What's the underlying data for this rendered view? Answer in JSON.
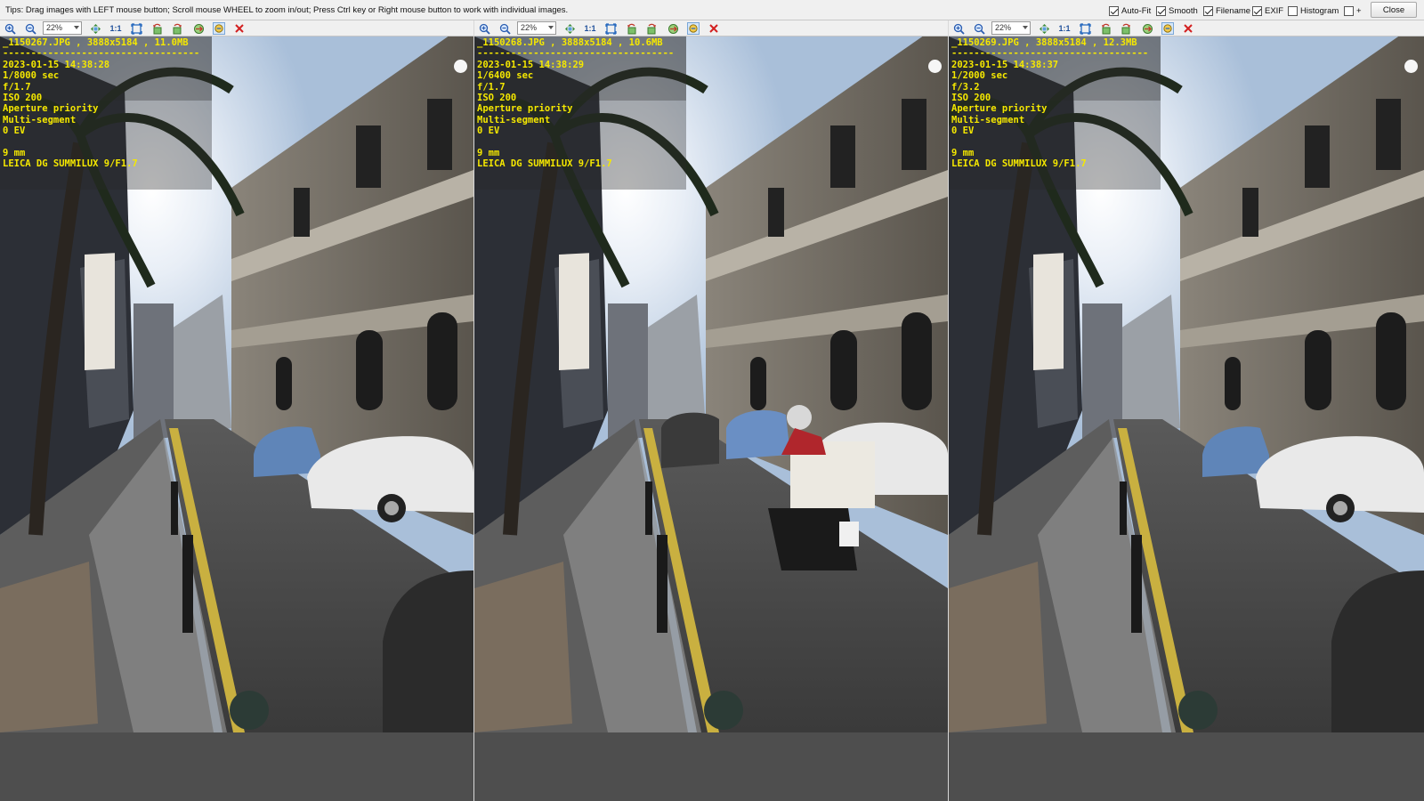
{
  "tips": "Tips: Drag images with LEFT mouse button; Scroll mouse WHEEL to zoom in/out; Press Ctrl key or Right mouse button to work with individual images.",
  "options": [
    {
      "label": "Auto-Fit",
      "checked": true
    },
    {
      "label": "Smooth",
      "checked": true
    },
    {
      "label": "Filename",
      "checked": true
    },
    {
      "label": "EXIF",
      "checked": true
    },
    {
      "label": "Histogram",
      "checked": false
    },
    {
      "label": "+",
      "checked": false
    }
  ],
  "close_label": "Close",
  "panels": [
    {
      "zoom": "22%",
      "header": "_1150267.JPG , 3888x5184 , 11.0MB",
      "separator": "-----------------------------------",
      "datetime": "2023-01-15 14:38:28",
      "shutter": "1/8000 sec",
      "aperture": "f/1.7",
      "iso": "ISO 200",
      "mode": "Aperture priority",
      "metering": "Multi-segment",
      "ev": "0 EV",
      "focal": "9 mm",
      "lens": "LEICA DG SUMMILUX 9/F1.7",
      "scene": "street-parked-cars"
    },
    {
      "zoom": "22%",
      "header": "_1150268.JPG , 3888x5184 , 10.6MB",
      "separator": "-----------------------------------",
      "datetime": "2023-01-15 14:38:29",
      "shutter": "1/6400 sec",
      "aperture": "f/1.7",
      "iso": "ISO 200",
      "mode": "Aperture priority",
      "metering": "Multi-segment",
      "ev": "0 EV",
      "focal": "9 mm",
      "lens": "LEICA DG SUMMILUX 9/F1.7",
      "scene": "street-scooter-rider"
    },
    {
      "zoom": "22%",
      "header": "_1150269.JPG , 3888x5184 , 12.3MB",
      "separator": "-----------------------------------",
      "datetime": "2023-01-15 14:38:37",
      "shutter": "1/2000 sec",
      "aperture": "f/3.2",
      "iso": "ISO 200",
      "mode": "Aperture priority",
      "metering": "Multi-segment",
      "ev": "0 EV",
      "focal": "9 mm",
      "lens": "LEICA DG SUMMILUX 9/F1.7",
      "scene": "street-parked-cars"
    }
  ],
  "toolbar_icons": [
    "zoom-in-icon",
    "zoom-out-icon",
    "fit-icon",
    "actual-size-icon",
    "fullscreen-icon",
    "rotate-left-icon",
    "rotate-right-icon",
    "flip-icon",
    "sync-icon",
    "remove-icon"
  ],
  "toolbar_actual_size_label": "1:1"
}
